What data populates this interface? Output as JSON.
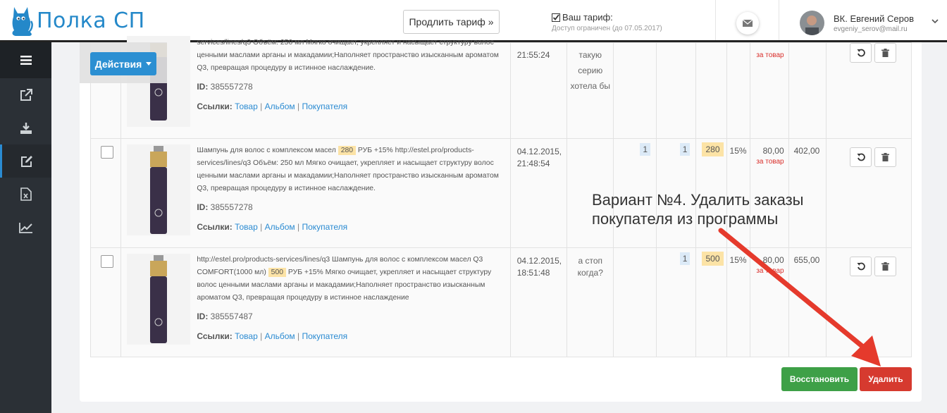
{
  "header": {
    "logo_text": "Полка СП",
    "renew_label": "Продлить тариф",
    "tariff_title": "Ваш тариф:",
    "tariff_sub": "Доступ ограничен (до 07.05.2017)",
    "user_name": "ВК. Евгений Серов",
    "user_email": "evgeniy_serov@mail.ru"
  },
  "sidebar": {
    "items": [
      "menu-icon",
      "external-link-icon",
      "download-icon",
      "edit-icon",
      "excel-file-icon",
      "chart-icon"
    ],
    "active": "edit-icon"
  },
  "toolbar": {
    "actions_label": "Действия"
  },
  "rows": [
    {
      "desc_parts": [
        "services/lines/q3 Объём: 250 мл Мягко очищает, укрепляет и насыщает структуру волос ценными маслами арганы и макадамии;Наполняет пространство изысканным ароматом Q3, превращая процедуру в истинное наслаждение."
      ],
      "id_label": "ID:",
      "id": "385557278",
      "links_label": "Ссылки:",
      "link_item": "Товар",
      "link_album": "Альбом",
      "link_buyer": "Покупателя",
      "date": "",
      "time": "21:55:24",
      "comment": [
        "такую",
        "серию",
        "хотела бы"
      ],
      "qty1": "",
      "qty2": "",
      "price": "",
      "pct": "",
      "cost": "",
      "per_item": "за товар",
      "total": ""
    },
    {
      "desc_before": "Шампунь для волос с комплексом масел",
      "desc_price": "280",
      "desc_after": "РУБ +15% http://estel.pro/products-services/lines/q3 Объём: 250 мл Мягко очищает, укрепляет и насыщает структуру волос ценными маслами арганы и макадамии;Наполняет пространство изысканным ароматом Q3, превращая процедуру в истинное наслаждение.",
      "id_label": "ID:",
      "id": "385557278",
      "links_label": "Ссылки:",
      "link_item": "Товар",
      "link_album": "Альбом",
      "link_buyer": "Покупателя",
      "date": "04.12.2015,",
      "time": "21:48:54",
      "comment": [],
      "qty1": "1",
      "qty2": "1",
      "price": "280",
      "pct": "15%",
      "cost": "80,00",
      "per_item": "за товар",
      "total": "402,00"
    },
    {
      "desc_before": "http://estel.pro/products-services/lines/q3 Шампунь для волос с комплексом масел Q3 COMFORT(1000 мл)",
      "desc_price": "500",
      "desc_after": "РУБ +15% Мягко очищает, укрепляет и насыщает структуру волос ценными маслами арганы и макадамии;Наполняет пространство изысканным ароматом Q3, превращая процедуру в истинное наслаждение",
      "id_label": "ID:",
      "id": "385557487",
      "links_label": "Ссылки:",
      "link_item": "Товар",
      "link_album": "Альбом",
      "link_buyer": "Покупателя",
      "date": "04.12.2015,",
      "time": "18:51:48",
      "comment": [
        "а стоп",
        "когда?"
      ],
      "qty1": "",
      "qty2": "1",
      "price": "500",
      "pct": "15%",
      "cost": "80,00",
      "per_item": "за товар",
      "total": "655,00"
    }
  ],
  "footer": {
    "restore_label": "Восстановить",
    "delete_label": "Удалить"
  },
  "annotation": {
    "line1": "Вариант №4. Удалить заказы",
    "line2": "покупателя из программы"
  },
  "colors": {
    "brand": "#2488c9",
    "accent_blue": "#2b8fd2",
    "success": "#3ea047",
    "danger": "#d63a2f",
    "arrow": "#e53a2c"
  }
}
